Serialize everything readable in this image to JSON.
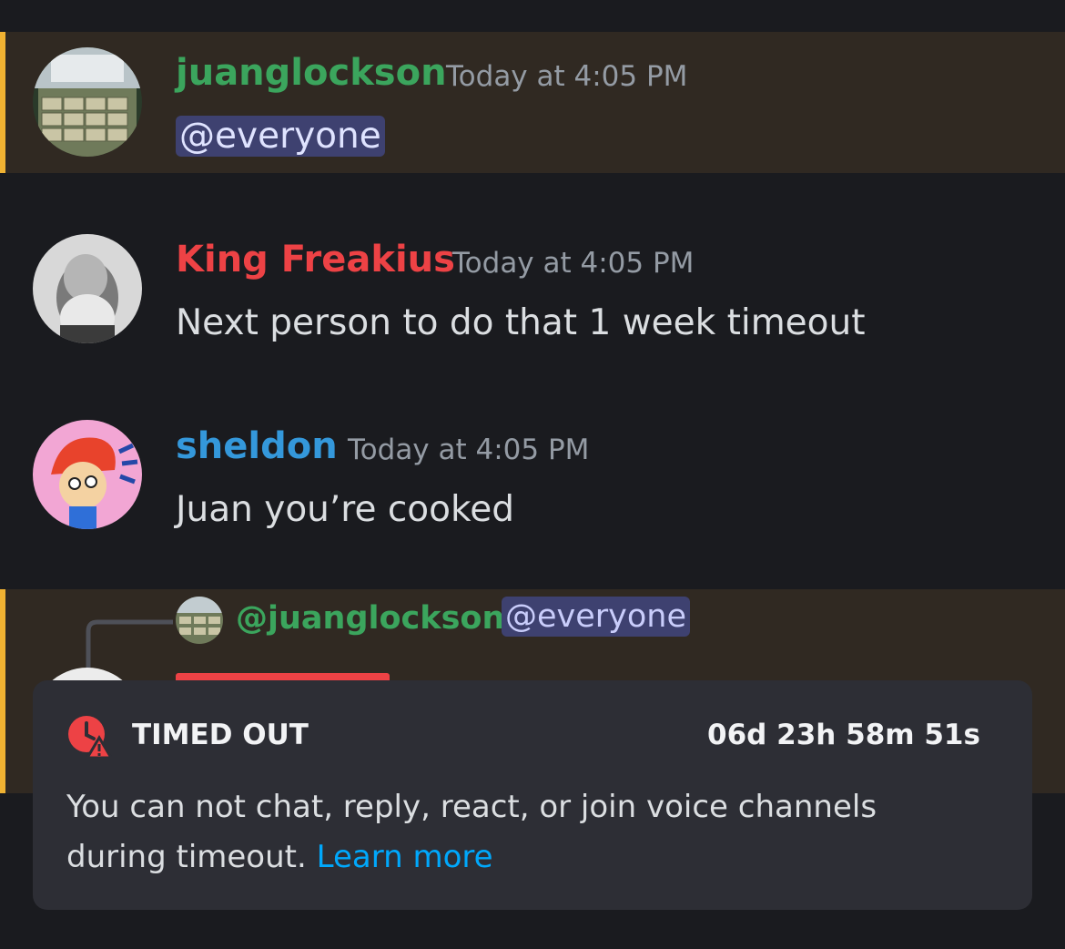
{
  "messages": [
    {
      "author": "juanglockson",
      "author_color": "#3ba55d",
      "time": "Today at 4:05 PM",
      "mention": "@everyone"
    },
    {
      "author": "King Freakius",
      "author_color": "#ed4245",
      "time": "Today at 4:05 PM",
      "text": "Next person to do that 1 week timeout"
    },
    {
      "author": "sheldon",
      "author_color": "#3498db",
      "time": "Today at 4:05 PM",
      "text": "Juan you’re cooked"
    }
  ],
  "reply": {
    "replied_author": "@juanglockson",
    "replied_mention": "@everyone"
  },
  "timeout_banner": {
    "title": "TIMED OUT",
    "countdown": "06d 23h 58m 51s",
    "body": "You can not chat, reply, react, or join voice channels",
    "body_line2": "during timeout.",
    "link": "Learn more",
    "icon": "clock-warning-icon",
    "accent": "#ed4245",
    "link_color": "#00a8fc"
  }
}
